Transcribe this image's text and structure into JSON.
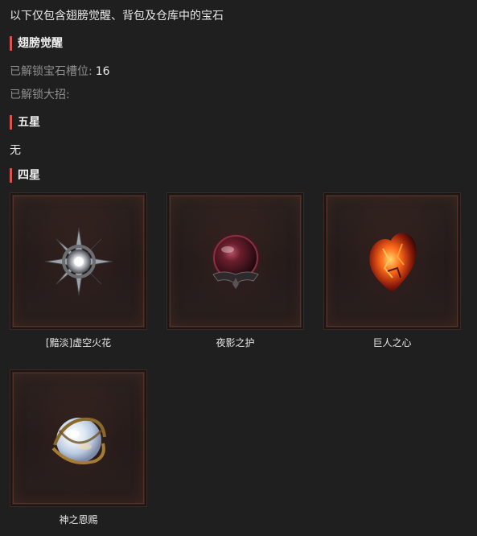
{
  "intro": "以下仅包含翅膀觉醒、背包及仓库中的宝石",
  "sections": {
    "wings": {
      "title": "翅膀觉醒",
      "slots_label": "已解锁宝石槽位:",
      "slots_value": "16",
      "ultimate_label": "已解锁大招:",
      "ultimate_value": ""
    },
    "five_star": {
      "title": "五星",
      "empty_text": "无"
    },
    "four_star": {
      "title": "四星",
      "gems": [
        {
          "name": "[黯淡]虚空火花",
          "icon": "void-spark-icon"
        },
        {
          "name": "夜影之护",
          "icon": "night-shadow-orb-icon"
        },
        {
          "name": "巨人之心",
          "icon": "giant-heart-icon"
        },
        {
          "name": "神之恩赐",
          "icon": "gods-gift-orb-icon"
        }
      ]
    }
  },
  "colors": {
    "accent": "#d9534f",
    "background": "#1f1f1f",
    "muted": "#8e8e8e"
  }
}
